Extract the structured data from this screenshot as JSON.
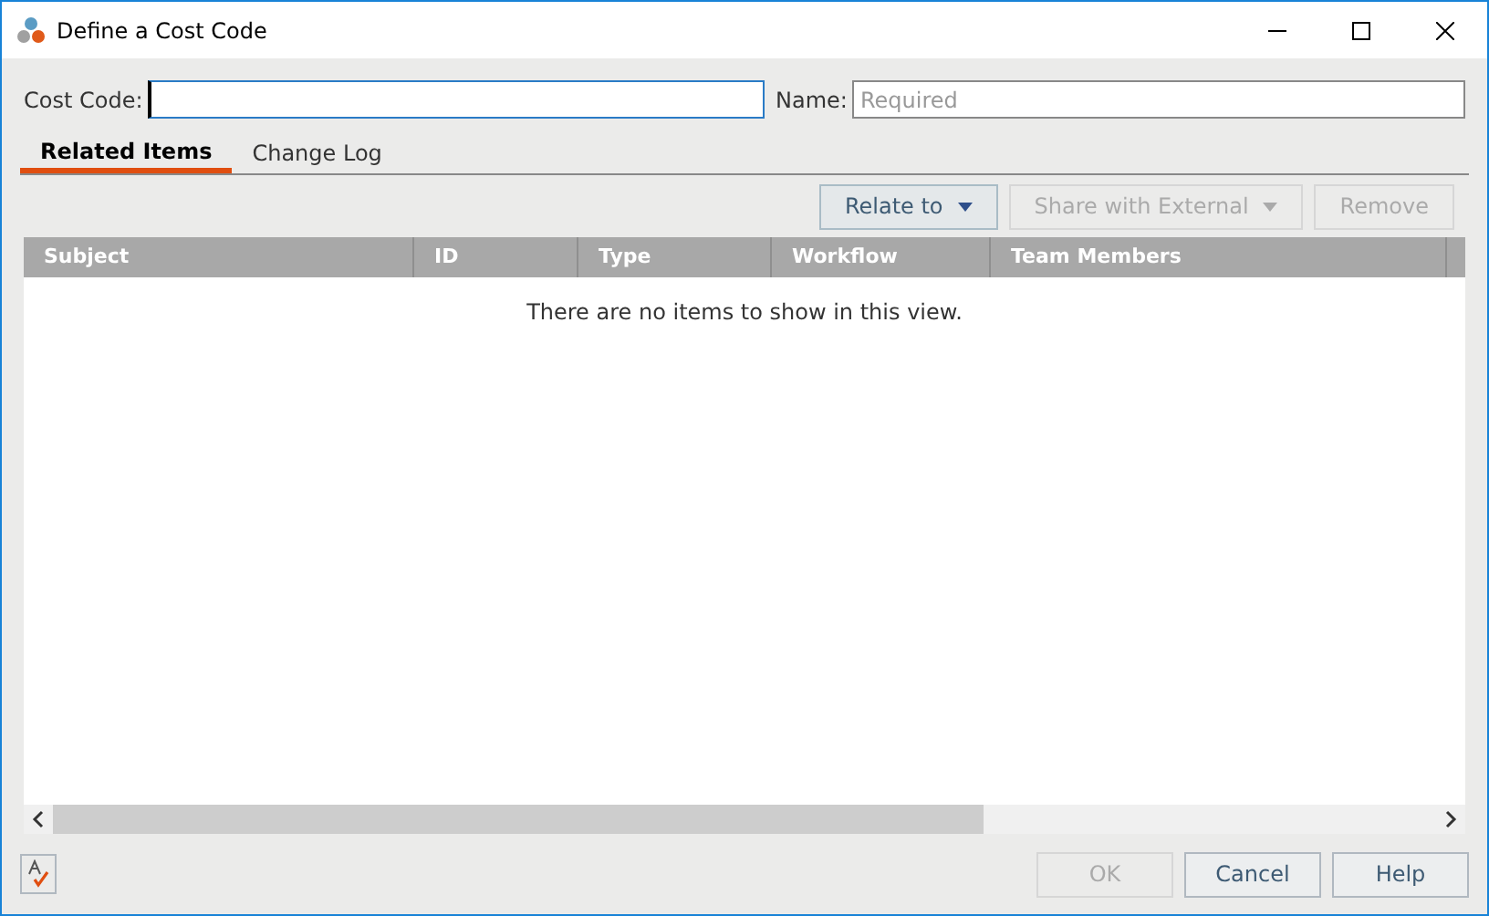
{
  "window": {
    "title": "Define a Cost Code"
  },
  "fields": [
    {
      "label": "Cost Code:",
      "focused": true
    },
    {
      "label": "Name:",
      "placeholder": "Required",
      "focused": false
    }
  ],
  "tabs": [
    {
      "label": "Related Items",
      "selected": true
    },
    {
      "label": "Change Log",
      "selected": false
    }
  ],
  "toolbar": [
    {
      "label": "Relate to",
      "dropdown": true,
      "disabled": false
    },
    {
      "label": "Share with External",
      "dropdown": true,
      "disabled": true
    },
    {
      "label": "Remove",
      "dropdown": false,
      "disabled": true
    }
  ],
  "table": {
    "columns": [
      "Subject",
      "ID",
      "Type",
      "Workflow",
      "Team Members"
    ],
    "empty_message": "There are no items to show in this view."
  },
  "footer_buttons": [
    {
      "label": "OK",
      "disabled": true
    },
    {
      "label": "Cancel",
      "disabled": false
    },
    {
      "label": "Help",
      "disabled": false
    }
  ]
}
